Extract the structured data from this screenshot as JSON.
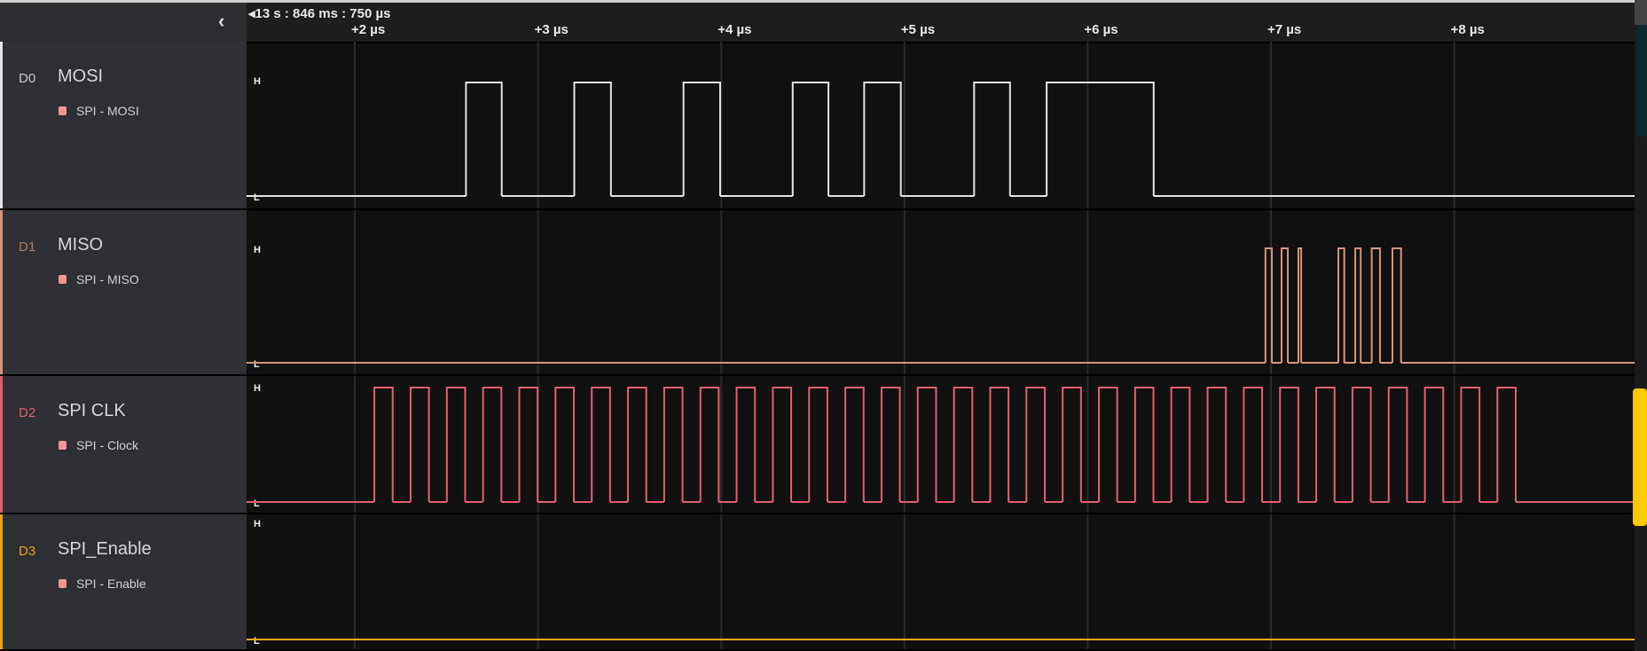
{
  "timeline": {
    "origin_label": "13 s : 846 ms : 750 µs",
    "ticks": [
      {
        "label": "+2 µs",
        "t": 2
      },
      {
        "label": "+3 µs",
        "t": 3
      },
      {
        "label": "+4 µs",
        "t": 4
      },
      {
        "label": "+5 µs",
        "t": 5
      },
      {
        "label": "+6 µs",
        "t": 6
      },
      {
        "label": "+7 µs",
        "t": 7
      },
      {
        "label": "+8 µs",
        "t": 8
      }
    ],
    "collapse_icon": "chevron-left-icon"
  },
  "level_labels": {
    "high": "H",
    "low": "L"
  },
  "channels": [
    {
      "index": "D0",
      "name": "MOSI",
      "analyzer": "SPI - MOSI",
      "color": "#e4e4e4",
      "index_color": "#c8c8c8",
      "edges": [
        2.607,
        2.802,
        3.198,
        3.398,
        3.794,
        3.994,
        4.39,
        4.585,
        4.78,
        4.98,
        5.38,
        5.576,
        5.776,
        6.36
      ]
    },
    {
      "index": "D1",
      "name": "MISO",
      "analyzer": "SPI - MISO",
      "color": "#d4957a",
      "index_color": "#b07a5e",
      "edges": [
        6.97,
        7.005,
        7.058,
        7.092,
        7.15,
        7.165,
        7.368,
        7.4,
        7.46,
        7.49,
        7.55,
        7.595,
        7.663,
        7.71
      ]
    },
    {
      "index": "D2",
      "name": "SPI CLK",
      "analyzer": "SPI - Clock",
      "color": "#e0606e",
      "index_color": "#e0606e",
      "clock": {
        "first_rise": 2.107,
        "period": 0.1977,
        "high_time": 0.1,
        "pulses": 32
      }
    },
    {
      "index": "D3",
      "name": "SPI_Enable",
      "analyzer": "SPI - Enable",
      "color": "#e8a317",
      "index_color": "#e8a317",
      "edges": []
    }
  ],
  "analyzer_dot_color": "#f49494",
  "scroll_thumb_color": "#ffc800"
}
